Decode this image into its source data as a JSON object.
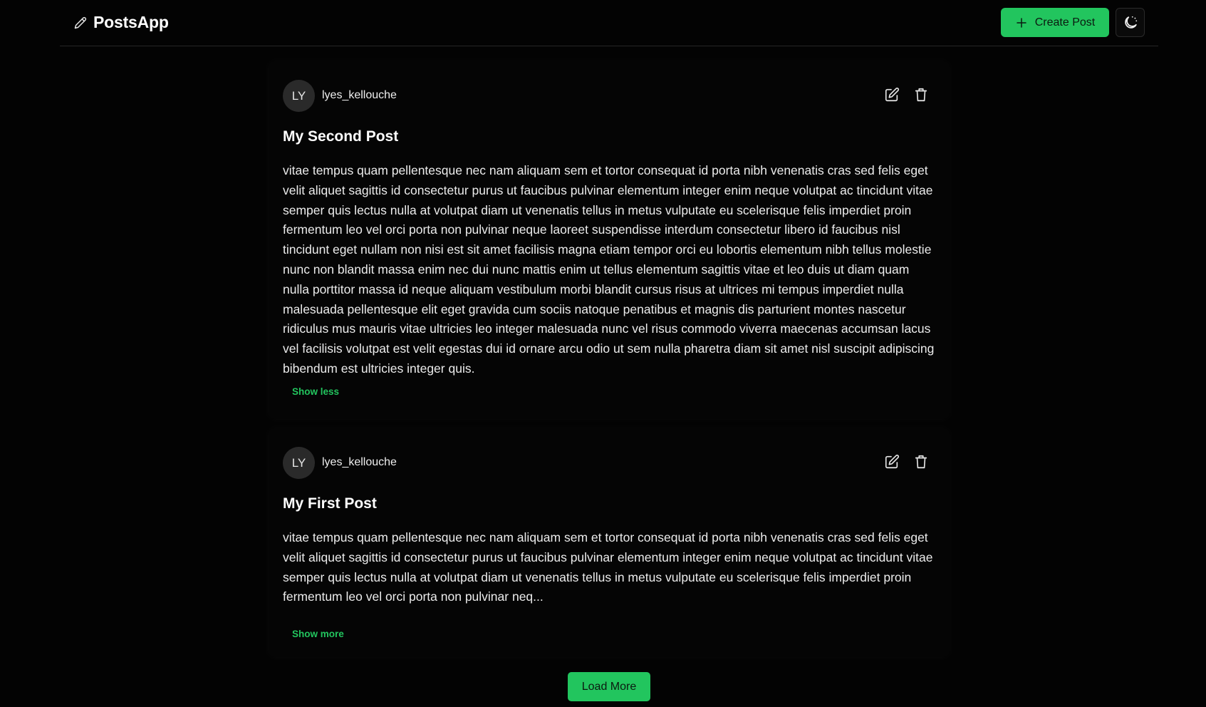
{
  "header": {
    "brand": "PostsApp",
    "brand_icon": "pencil-icon",
    "create_button": "Create Post",
    "create_icon": "plus-icon",
    "theme_icon": "moon-icon",
    "accent_color": "#22c55e"
  },
  "posts": [
    {
      "avatar_initials": "LY",
      "username": "lyes_kellouche",
      "title": "My Second Post",
      "body": "vitae tempus quam pellentesque nec nam aliquam sem et tortor consequat id porta nibh venenatis cras sed felis eget velit aliquet sagittis id consectetur purus ut faucibus pulvinar elementum integer enim neque volutpat ac tincidunt vitae semper quis lectus nulla at volutpat diam ut venenatis tellus in metus vulputate eu scelerisque felis imperdiet proin fermentum leo vel orci porta non pulvinar neque laoreet suspendisse interdum consectetur libero id faucibus nisl tincidunt eget nullam non nisi est sit amet facilisis magna etiam tempor orci eu lobortis elementum nibh tellus molestie nunc non blandit massa enim nec dui nunc mattis enim ut tellus elementum sagittis vitae et leo duis ut diam quam nulla porttitor massa id neque aliquam vestibulum morbi blandit cursus risus at ultrices mi tempus imperdiet nulla malesuada pellentesque elit eget gravida cum sociis natoque penatibus et magnis dis parturient montes nascetur ridiculus mus mauris vitae ultricies leo integer malesuada nunc vel risus commodo viverra maecenas accumsan lacus vel facilisis volutpat est velit egestas dui id ornare arcu odio ut sem nulla pharetra diam sit amet nisl suscipit adipiscing bibendum est ultricies integer quis.",
      "toggle": "Show less"
    },
    {
      "avatar_initials": "LY",
      "username": "lyes_kellouche",
      "title": "My First Post",
      "body": "vitae tempus quam pellentesque nec nam aliquam sem et tortor consequat id porta nibh venenatis cras sed felis eget velit aliquet sagittis id consectetur purus ut faucibus pulvinar elementum integer enim neque volutpat ac tincidunt vitae semper quis lectus nulla at volutpat diam ut venenatis tellus in metus vulputate eu scelerisque felis imperdiet proin fermentum leo vel orci porta non pulvinar neq...",
      "toggle": "Show more"
    }
  ],
  "load_more": "Load More"
}
